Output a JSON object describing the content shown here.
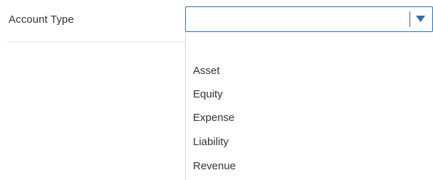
{
  "field": {
    "label": "Account Type",
    "selected_value": ""
  },
  "dropdown": {
    "options": [
      {
        "label": ""
      },
      {
        "label": "Asset"
      },
      {
        "label": "Equity"
      },
      {
        "label": "Expense"
      },
      {
        "label": "Liability"
      },
      {
        "label": "Revenue"
      }
    ]
  },
  "colors": {
    "accent": "#2b6fb6",
    "text": "#333333",
    "divider": "#e6e6e6"
  },
  "icons": {
    "arrow": "chevron-down-icon"
  }
}
